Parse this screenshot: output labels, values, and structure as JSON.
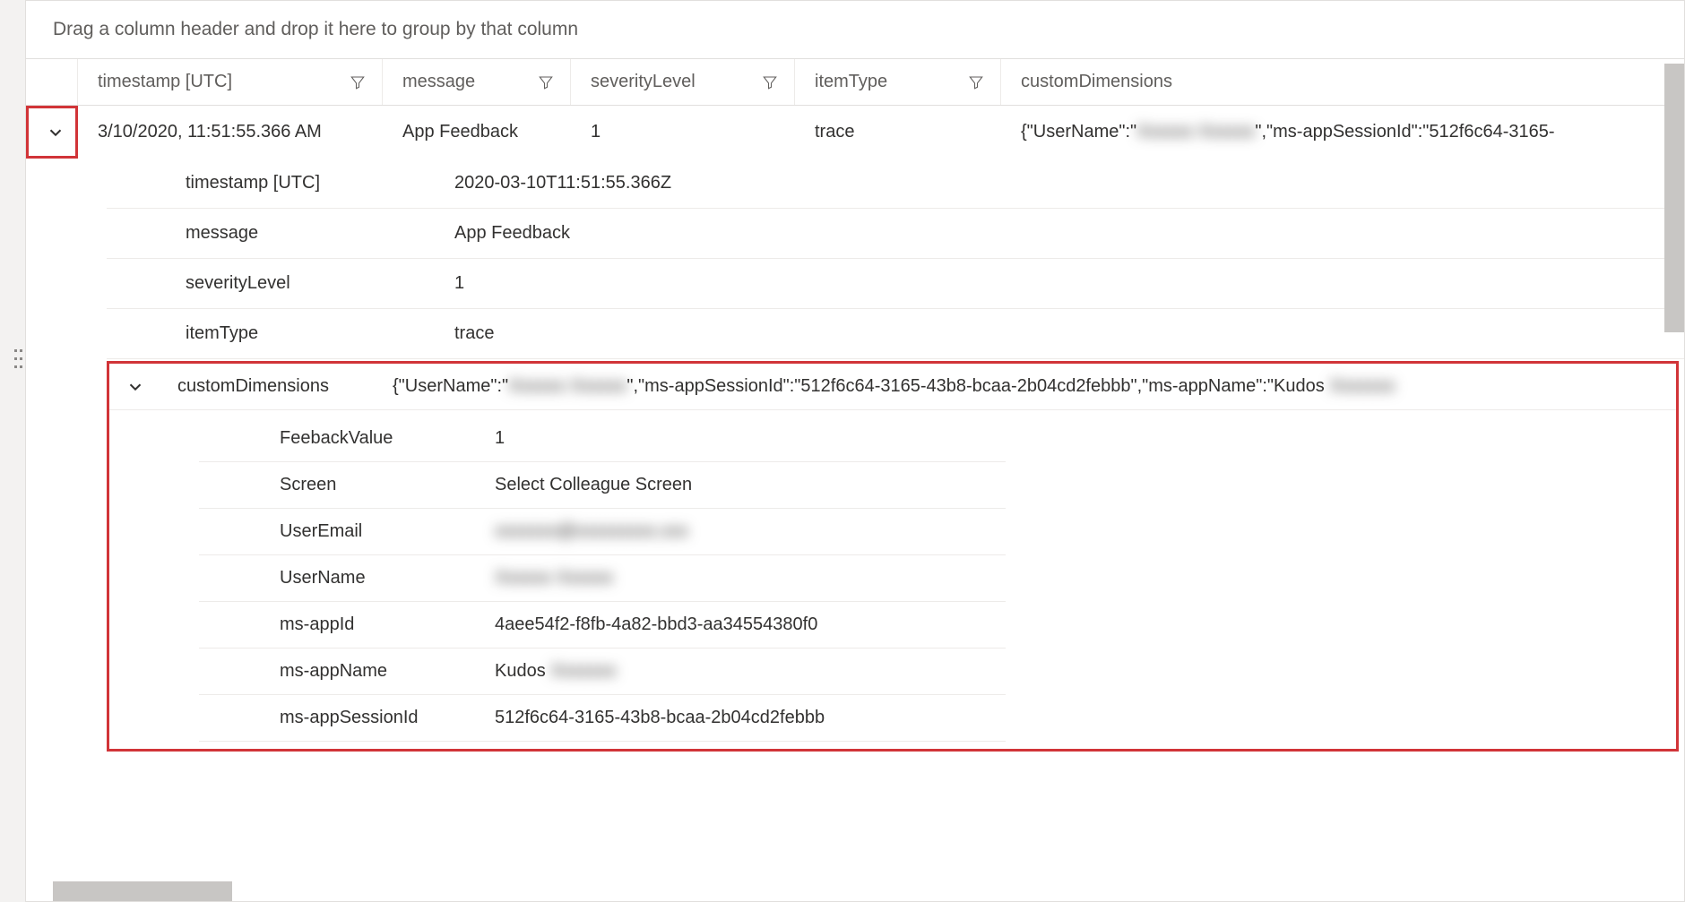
{
  "groupBar": {
    "hint": "Drag a column header and drop it here to group by that column"
  },
  "columns": {
    "timestamp": "timestamp [UTC]",
    "message": "message",
    "severityLevel": "severityLevel",
    "itemType": "itemType",
    "customDimensions": "customDimensions"
  },
  "row": {
    "timestamp": "3/10/2020, 11:51:55.366 AM",
    "message": "App Feedback",
    "severityLevel": "1",
    "itemType": "trace",
    "customDimensionsPreviewPrefix": "{\"UserName\":\"",
    "customDimensionsPreviewSuffix": "\",\"ms-appSessionId\":\"512f6c64-3165-"
  },
  "detail": {
    "timestamp": {
      "label": "timestamp [UTC]",
      "value": "2020-03-10T11:51:55.366Z"
    },
    "message": {
      "label": "message",
      "value": "App Feedback"
    },
    "severityLevel": {
      "label": "severityLevel",
      "value": "1"
    },
    "itemType": {
      "label": "itemType",
      "value": "trace"
    },
    "customDimensions": {
      "label": "customDimensions",
      "previewPrefix": "{\"UserName\":\"",
      "previewMid": "\",\"ms-appSessionId\":\"512f6c64-3165-43b8-bcaa-2b04cd2febbb\",\"ms-appName\":\"Kudos ",
      "items": {
        "FeebackValue": {
          "k": "FeebackValue",
          "v": "1"
        },
        "Screen": {
          "k": "Screen",
          "v": "Select Colleague Screen"
        },
        "UserEmail": {
          "k": "UserEmail",
          "v": ""
        },
        "UserName": {
          "k": "UserName",
          "v": ""
        },
        "msAppId": {
          "k": "ms-appId",
          "v": "4aee54f2-f8fb-4a82-bbd3-aa34554380f0"
        },
        "msAppName": {
          "k": "ms-appName",
          "v": "Kudos"
        },
        "msAppSessionId": {
          "k": "ms-appSessionId",
          "v": "512f6c64-3165-43b8-bcaa-2b04cd2febbb"
        }
      }
    }
  },
  "redacted": {
    "userNameShort": "Xxxxxx Xxxxxx",
    "userEmail": "xxxxxxx@xxxxxxxxx.xxx",
    "userName": "Xxxxxx Xxxxxx",
    "appNameSuffix": "Xxxxxxx"
  }
}
